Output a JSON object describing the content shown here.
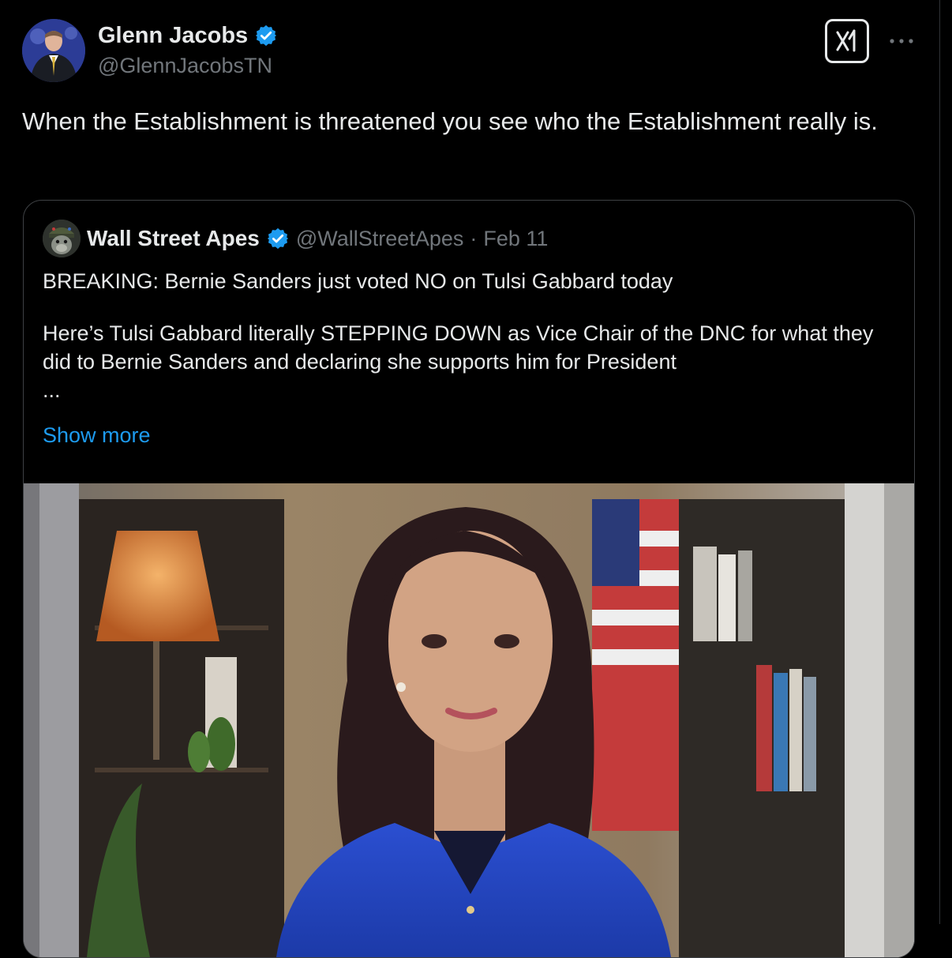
{
  "tweet": {
    "author": {
      "name": "Glenn Jacobs",
      "handle": "@GlennJacobsTN",
      "verified": true
    },
    "text": "When the Establishment is threatened you see who the Establishment really is.",
    "actions": {
      "grok_icon": "grok-icon",
      "more_icon": "more-icon"
    }
  },
  "quoted_tweet": {
    "author": {
      "name": "Wall Street Apes",
      "handle": "@WallStreetApes",
      "verified": true
    },
    "separator": "·",
    "date": "Feb 11",
    "text_lines": [
      "BREAKING: Bernie Sanders just voted NO on Tulsi Gabbard today",
      "Here’s Tulsi Gabbard literally STEPPING DOWN as Vice Chair of the DNC for what they did to Bernie Sanders and declaring she supports him for President",
      "..."
    ],
    "show_more_label": "Show more",
    "media": {
      "type": "video-thumbnail"
    }
  },
  "colors": {
    "background": "#000000",
    "text_primary": "#e7e9ea",
    "text_secondary": "#71767b",
    "link": "#1d9bf0",
    "verified_badge": "#1d9bf0",
    "border": "#2f3336"
  }
}
